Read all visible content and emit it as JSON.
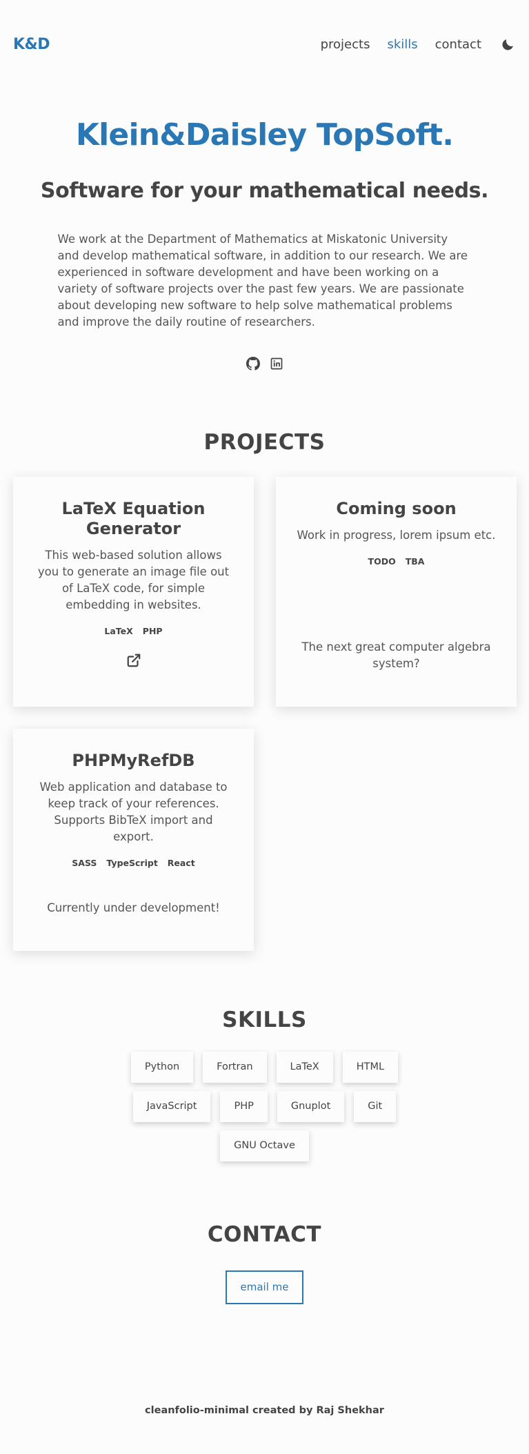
{
  "header": {
    "logo": "K&D",
    "nav": [
      "projects",
      "skills",
      "contact"
    ],
    "active_nav": "skills",
    "theme_icon": "moon-icon"
  },
  "about": {
    "title": "Klein&Daisley TopSoft.",
    "subtitle": "Software for your mathematical needs.",
    "description": "We work at the Department of Mathematics at Miskatonic University and develop mathematical software, in addition to our research. We are experienced in software development and have been working on a variety of software projects over the past few years. We are passionate about developing new software to help solve mathematical problems and improve the daily routine of researchers.",
    "socials": [
      "github-icon",
      "linkedin-icon"
    ]
  },
  "projects": {
    "title": "PROJECTS",
    "items": [
      {
        "title": "LaTeX Equation Generator",
        "description": "This web-based solution allows you to generate an image file out of LaTeX code, for simple embedding in websites.",
        "stack": [
          "LaTeX",
          "PHP"
        ],
        "link_icon": "external-link-icon"
      },
      {
        "title": "Coming soon",
        "description": "Work in progress, lorem ipsum etc.",
        "stack": [
          "TODO",
          "TBA"
        ],
        "footer": "The next great computer algebra system?"
      },
      {
        "title": "PHPMyRefDB",
        "description": "Web application and database to keep track of your references. Supports BibTeX import and export.",
        "stack": [
          "SASS",
          "TypeScript",
          "React"
        ],
        "footer": "Currently under development!"
      }
    ]
  },
  "skills": {
    "title": "SKILLS",
    "items": [
      "Python",
      "Fortran",
      "LaTeX",
      "HTML",
      "JavaScript",
      "PHP",
      "Gnuplot",
      "Git",
      "GNU Octave"
    ]
  },
  "contact": {
    "title": "CONTACT",
    "button": "email me"
  },
  "footer": {
    "text": "cleanfolio-minimal created by Raj Shekhar"
  },
  "colors": {
    "accent": "#2978b5",
    "text_dark": "#444444",
    "background": "#fcfcfc"
  }
}
